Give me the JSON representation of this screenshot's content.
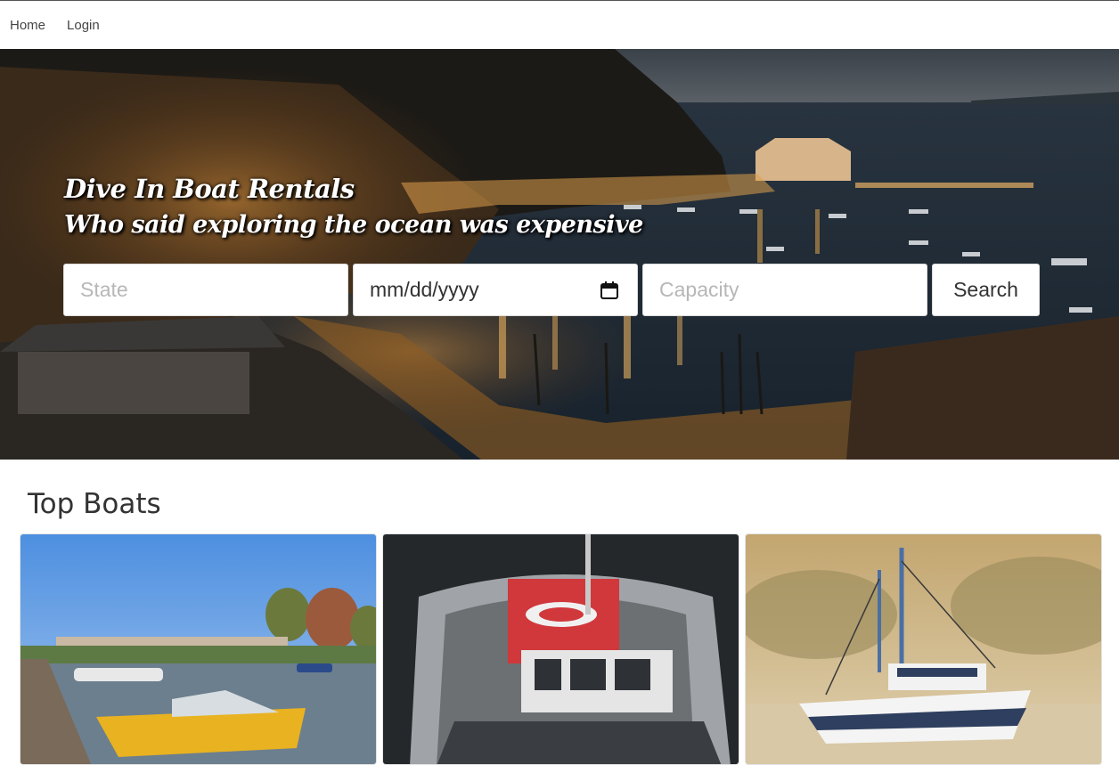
{
  "nav": {
    "items": [
      {
        "label": "Home"
      },
      {
        "label": "Login"
      }
    ]
  },
  "hero": {
    "title": "Dive In Boat Rentals",
    "subtitle": "Who said exploring the ocean was expensive",
    "search": {
      "state_placeholder": "State",
      "date_placeholder": "mm/dd/yyyy",
      "capacity_placeholder": "Capacity",
      "search_label": "Search"
    }
  },
  "top_boats": {
    "heading": "Top Boats",
    "cards": [
      {
        "image": "yellow-motorboat-at-marina"
      },
      {
        "image": "red-white-fishing-boat-overhead"
      },
      {
        "image": "white-fishing-trawler-sunset"
      }
    ]
  },
  "colors": {
    "text": "#333333",
    "background": "#ffffff",
    "hero_overlay": "#11161d"
  }
}
